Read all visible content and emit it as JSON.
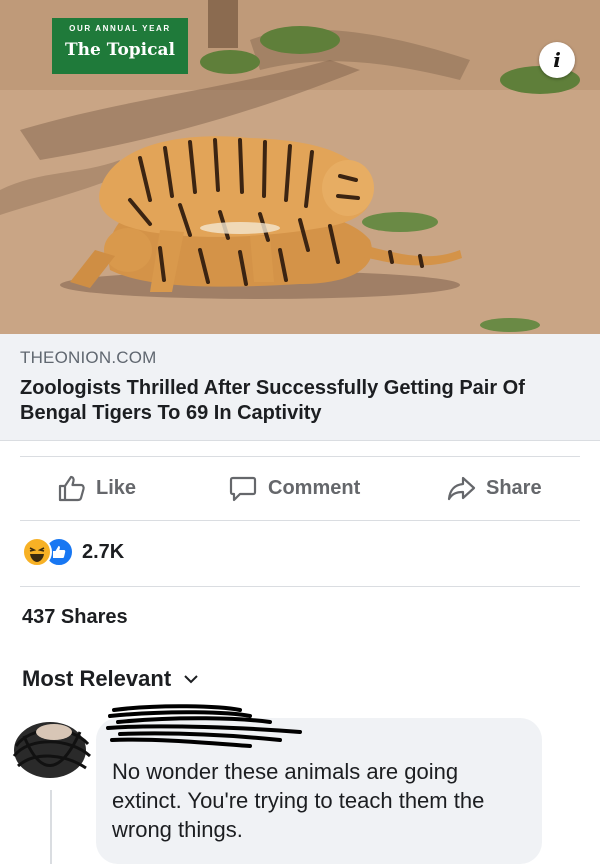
{
  "preview": {
    "badge_kicker": "OUR ANNUAL YEAR",
    "badge_title": "The Topical",
    "info_icon": "i",
    "domain": "THEONION.COM",
    "headline": "Zoologists Thrilled After Successfully Getting Pair Of Bengal Tigers To 69 In Captivity"
  },
  "actions": {
    "like_label": "Like",
    "comment_label": "Comment",
    "share_label": "Share"
  },
  "engagement": {
    "reaction_count": "2.7K",
    "reaction_icons": [
      "haha-icon",
      "like-icon"
    ],
    "shares_label": "437 Shares"
  },
  "comments": {
    "sort_label": "Most Relevant",
    "items": [
      {
        "text": "No wonder these animals are going extinct. You're trying to teach them the wrong things."
      }
    ]
  },
  "colors": {
    "badge_green": "#1f7a3a",
    "link_background": "#f0f2f5",
    "muted_text": "#65676b",
    "primary_text": "#1c1e21",
    "facebook_blue": "#1877f2",
    "haha_yellow": "#f7b125"
  }
}
